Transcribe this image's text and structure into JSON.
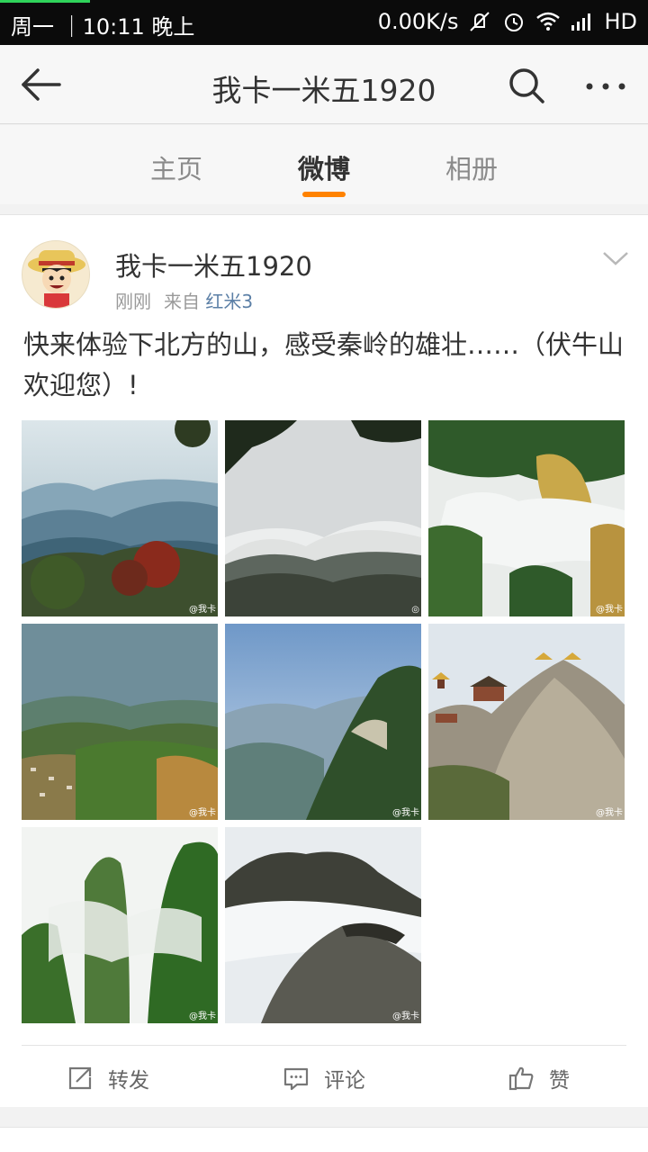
{
  "status_bar": {
    "left_text": "周一 ｜10:11 晚上",
    "speed": "0.00K/s",
    "network": "HD"
  },
  "header": {
    "title": "我卡一米五1920"
  },
  "tabs": [
    {
      "label": "主页"
    },
    {
      "label": "微博"
    },
    {
      "label": "相册"
    }
  ],
  "post": {
    "author": "我卡一米五1920",
    "time": "刚刚",
    "from_label": "来自",
    "source": "红米3",
    "text": "快来体验下北方的山，感受秦岭的雄壮……（伏牛山欢迎您）!",
    "watermark": "@我卡",
    "photos": [
      {
        "subject": "misty blue mountain ridges with red foliage"
      },
      {
        "subject": "pine branch over cloud sea"
      },
      {
        "subject": "golden cliffs above clouds"
      },
      {
        "subject": "valley village under blue hills"
      },
      {
        "subject": "forested ridge under blue sky"
      },
      {
        "subject": "temple on rocky peak"
      },
      {
        "subject": "green peaks in fog"
      },
      {
        "subject": "rocky peak emerging from clouds"
      }
    ]
  },
  "actions": {
    "repost": "转发",
    "comment": "评论",
    "like": "赞"
  },
  "colors": {
    "accent": "#ff8200",
    "link": "#5b7fa6"
  }
}
